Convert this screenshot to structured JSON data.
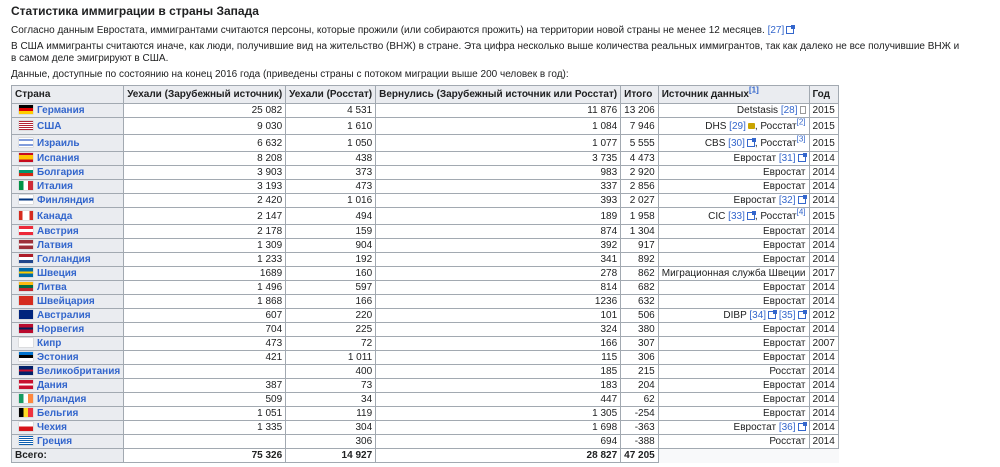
{
  "title": "Статистика иммиграции в страны Запада",
  "p1": "Согласно данным Евростата, иммигрантами считаются персоны, которые прожили (или собираются прожить) на территории новой страны не менее 12 месяцев.",
  "p1_ref": "[27]",
  "p2": "В США иммигранты считаются иначе, как люди, получившие вид на жительство (ВНЖ) в стране. Эта цифра несколько выше количества реальных иммигрантов, так как далеко не все получившие ВНЖ и в самом деле эмигрируют в США.",
  "p3": "Данные, доступные по состоянию на конец 2016 года (приведены страны с потоком миграции выше 200 человек в год):",
  "headers": [
    "Страна",
    "Уехали (Зарубежный источник)",
    "Уехали (Росстат)",
    "Вернулись (Зарубежный источник или Росстат)",
    "Итого",
    "Источник данных",
    "Год"
  ],
  "header_sup": "[1]",
  "rows": [
    {
      "country": "Германия",
      "flag": "de",
      "a": "25 082",
      "b": "4 531",
      "c": "11 876",
      "t": "13 206",
      "src": [
        [
          "t",
          "Detstasis "
        ],
        [
          "r",
          "[28]"
        ],
        [
          "i",
          "doc"
        ]
      ],
      "y": "2015"
    },
    {
      "country": "США",
      "flag": "us",
      "a": "9 030",
      "b": "1 610",
      "c": "1 084",
      "t": "7 946",
      "src": [
        [
          "t",
          "DHS "
        ],
        [
          "r",
          "[29]"
        ],
        [
          "i",
          "lock"
        ],
        [
          "t",
          ", Росстат"
        ],
        [
          "s",
          "[2]"
        ]
      ],
      "y": "2015"
    },
    {
      "country": "Израиль",
      "flag": "il",
      "a": "6 632",
      "b": "1 050",
      "c": "1 077",
      "t": "5 555",
      "src": [
        [
          "t",
          "CBS "
        ],
        [
          "r",
          "[30]"
        ],
        [
          "i",
          "ext"
        ],
        [
          "t",
          ", Росстат"
        ],
        [
          "s",
          "[3]"
        ]
      ],
      "y": "2015"
    },
    {
      "country": "Испания",
      "flag": "es",
      "a": "8 208",
      "b": "438",
      "c": "3 735",
      "t": "4 473",
      "src": [
        [
          "t",
          "Евростат "
        ],
        [
          "r",
          "[31]"
        ],
        [
          "i",
          "ext"
        ]
      ],
      "y": "2014"
    },
    {
      "country": "Болгария",
      "flag": "bg",
      "a": "3 903",
      "b": "373",
      "c": "983",
      "t": "2 920",
      "src": [
        [
          "t",
          "Евростат"
        ]
      ],
      "y": "2014"
    },
    {
      "country": "Италия",
      "flag": "it",
      "a": "3 193",
      "b": "473",
      "c": "337",
      "t": "2 856",
      "src": [
        [
          "t",
          "Евростат"
        ]
      ],
      "y": "2014"
    },
    {
      "country": "Финляндия",
      "flag": "fi",
      "a": "2 420",
      "b": "1 016",
      "c": "393",
      "t": "2 027",
      "src": [
        [
          "t",
          "Евростат "
        ],
        [
          "r",
          "[32]"
        ],
        [
          "i",
          "ext"
        ]
      ],
      "y": "2014"
    },
    {
      "country": "Канада",
      "flag": "ca",
      "a": "2 147",
      "b": "494",
      "c": "189",
      "t": "1 958",
      "src": [
        [
          "t",
          "CIC "
        ],
        [
          "r",
          "[33]"
        ],
        [
          "i",
          "ext"
        ],
        [
          "t",
          ", Росстат"
        ],
        [
          "s",
          "[4]"
        ]
      ],
      "y": "2015"
    },
    {
      "country": "Австрия",
      "flag": "at",
      "a": "2 178",
      "b": "159",
      "c": "874",
      "t": "1 304",
      "src": [
        [
          "t",
          "Евростат"
        ]
      ],
      "y": "2014"
    },
    {
      "country": "Латвия",
      "flag": "lv",
      "a": "1 309",
      "b": "904",
      "c": "392",
      "t": "917",
      "src": [
        [
          "t",
          "Евростат"
        ]
      ],
      "y": "2014"
    },
    {
      "country": "Голландия",
      "flag": "nl",
      "a": "1 233",
      "b": "192",
      "c": "341",
      "t": "892",
      "src": [
        [
          "t",
          "Евростат"
        ]
      ],
      "y": "2014"
    },
    {
      "country": "Швеция",
      "flag": "se",
      "a": "1689",
      "b": "160",
      "c": "278",
      "t": "862",
      "src": [
        [
          "t",
          "Миграционная служба Швеции"
        ]
      ],
      "y": "2017"
    },
    {
      "country": "Литва",
      "flag": "lt",
      "a": "1 496",
      "b": "597",
      "c": "814",
      "t": "682",
      "src": [
        [
          "t",
          "Евростат"
        ]
      ],
      "y": "2014"
    },
    {
      "country": "Швейцария",
      "flag": "ch",
      "a": "1 868",
      "b": "166",
      "c": "1236",
      "t": "632",
      "src": [
        [
          "t",
          "Евростат"
        ]
      ],
      "y": "2014"
    },
    {
      "country": "Австралия",
      "flag": "au",
      "a": "607",
      "b": "220",
      "c": "101",
      "t": "506",
      "src": [
        [
          "t",
          "DIBP "
        ],
        [
          "r",
          "[34]"
        ],
        [
          "i",
          "ext"
        ],
        [
          "t",
          " "
        ],
        [
          "r",
          "[35]"
        ],
        [
          "i",
          "ext"
        ]
      ],
      "y": "2012"
    },
    {
      "country": "Норвегия",
      "flag": "no",
      "a": "704",
      "b": "225",
      "c": "324",
      "t": "380",
      "src": [
        [
          "t",
          "Евростат"
        ]
      ],
      "y": "2014"
    },
    {
      "country": "Кипр",
      "flag": "cy",
      "a": "473",
      "b": "72",
      "c": "166",
      "t": "307",
      "src": [
        [
          "t",
          "Евростат"
        ]
      ],
      "y": "2007"
    },
    {
      "country": "Эстония",
      "flag": "ee",
      "a": "421",
      "b": "1 011",
      "c": "115",
      "t": "306",
      "src": [
        [
          "t",
          "Евростат"
        ]
      ],
      "y": "2014"
    },
    {
      "country": "Великобритания",
      "flag": "gb",
      "a": "",
      "b": "400",
      "c": "185",
      "t": "215",
      "src": [
        [
          "t",
          "Росстат"
        ]
      ],
      "y": "2014"
    },
    {
      "country": "Дания",
      "flag": "dk",
      "a": "387",
      "b": "73",
      "c": "183",
      "t": "204",
      "src": [
        [
          "t",
          "Евростат"
        ]
      ],
      "y": "2014"
    },
    {
      "country": "Ирландия",
      "flag": "ie",
      "a": "509",
      "b": "34",
      "c": "447",
      "t": "62",
      "src": [
        [
          "t",
          "Евростат"
        ]
      ],
      "y": "2014"
    },
    {
      "country": "Бельгия",
      "flag": "be",
      "a": "1 051",
      "b": "119",
      "c": "1 305",
      "t": "-254",
      "src": [
        [
          "t",
          "Евростат"
        ]
      ],
      "y": "2014"
    },
    {
      "country": "Чехия",
      "flag": "cz",
      "a": "1 335",
      "b": "304",
      "c": "1 698",
      "t": "-363",
      "src": [
        [
          "t",
          "Евростат "
        ],
        [
          "r",
          "[36]"
        ],
        [
          "i",
          "ext"
        ]
      ],
      "y": "2014"
    },
    {
      "country": "Греция",
      "flag": "gr",
      "a": "",
      "b": "306",
      "c": "694",
      "t": "-388",
      "src": [
        [
          "t",
          "Росстат"
        ]
      ],
      "y": "2014"
    }
  ],
  "total": {
    "label": "Всего:",
    "a": "75 326",
    "b": "14 927",
    "c": "28 827",
    "t": "47 205"
  },
  "colors": {
    "link": "#3366cc",
    "header_bg": "#eaecf0",
    "border": "#a2a9b1"
  }
}
